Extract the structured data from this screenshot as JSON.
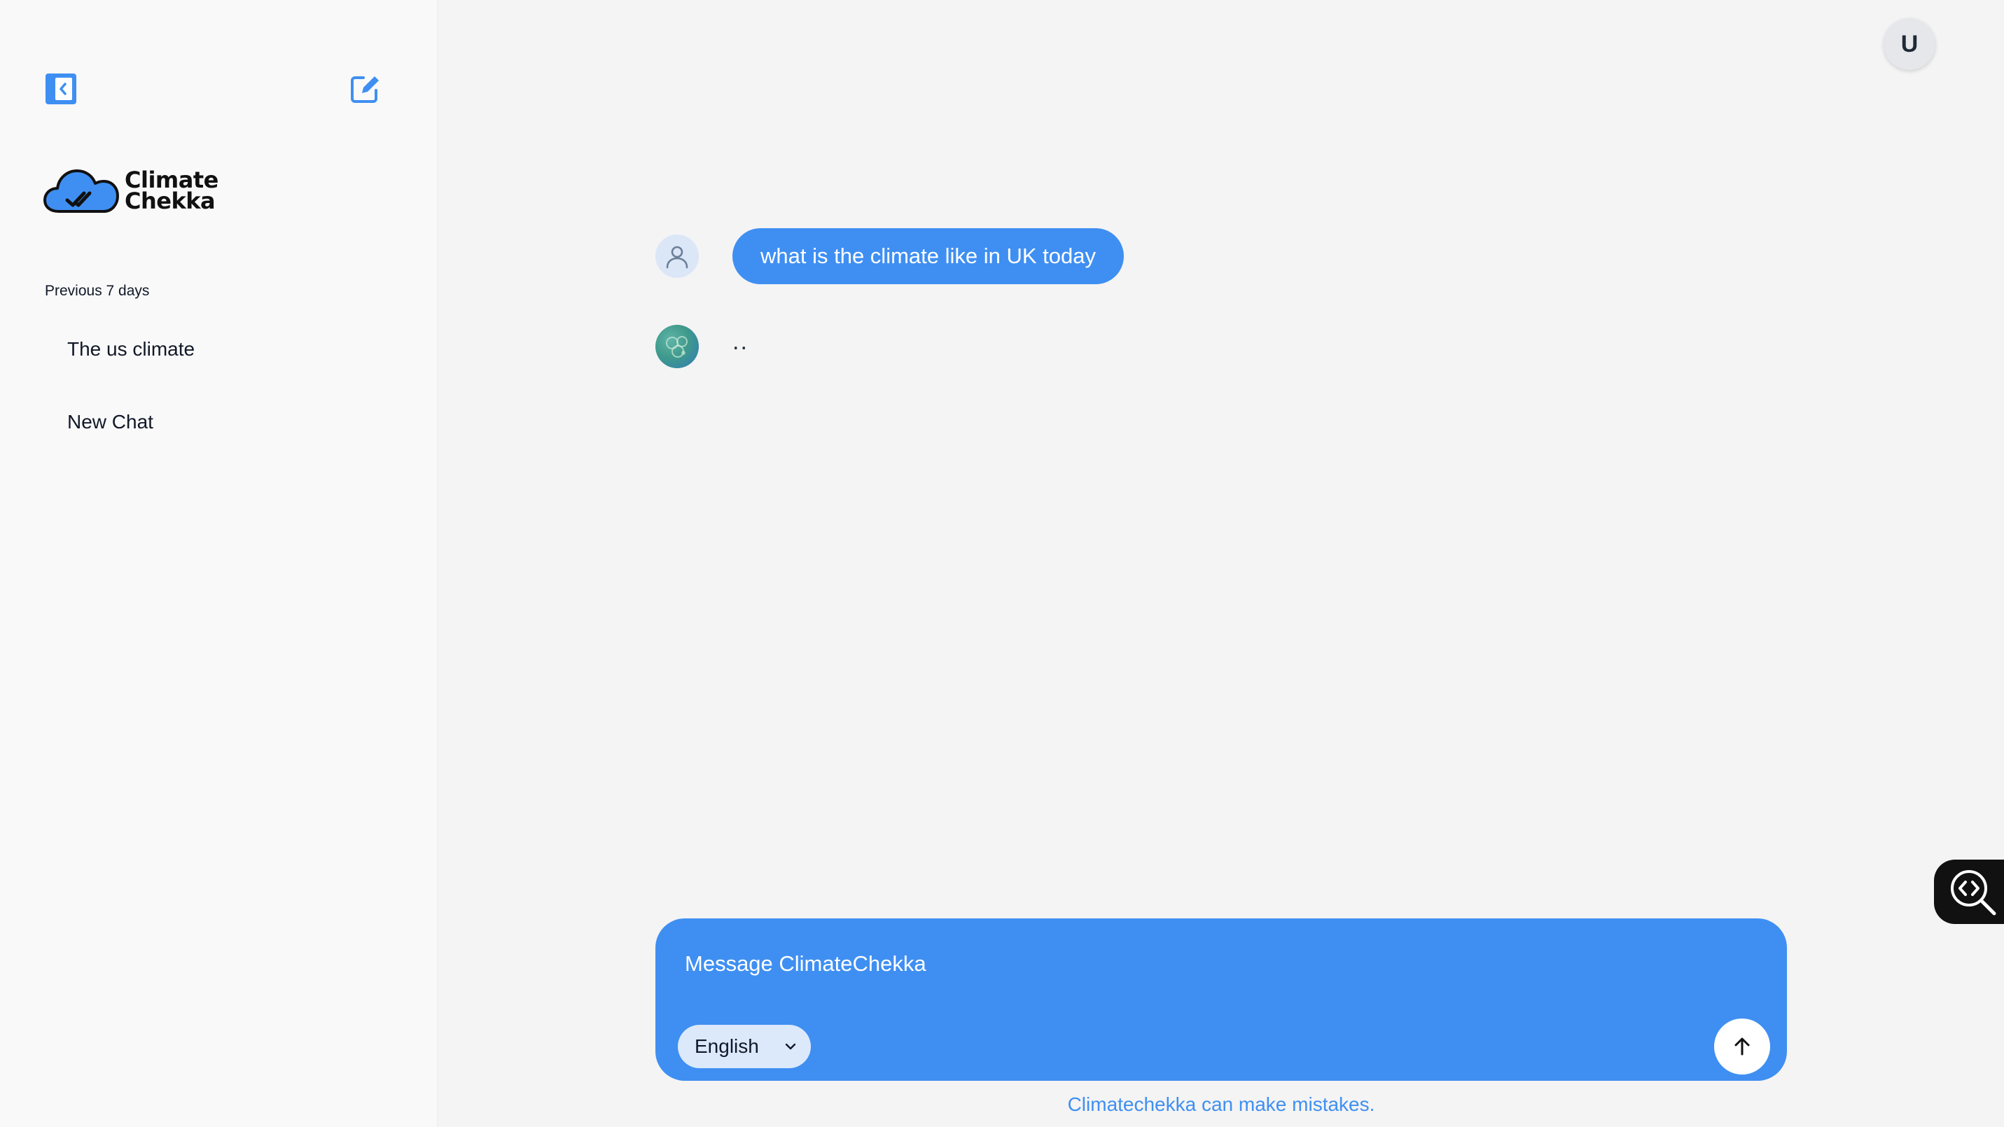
{
  "colors": {
    "accent": "#3f8ff2",
    "sidebar_bg": "#f9f9f9",
    "main_bg": "#f4f4f4"
  },
  "sidebar": {
    "collapse_icon": "sidebar-collapse-icon",
    "new_chat_icon": "compose-icon",
    "logo": {
      "line1": "Climate",
      "line2": "Chekka"
    },
    "section_label": "Previous 7 days",
    "history": [
      {
        "label": "The us climate"
      },
      {
        "label": "New Chat"
      }
    ]
  },
  "header": {
    "user_initial": "U"
  },
  "conversation": {
    "user_message": "what is the climate like in UK today",
    "bot_message": ".."
  },
  "composer": {
    "placeholder": "Message ClimateChekka",
    "language": "English",
    "send_icon": "arrow-up-icon"
  },
  "footer": {
    "disclaimer": "Climatechekka can make mistakes."
  }
}
